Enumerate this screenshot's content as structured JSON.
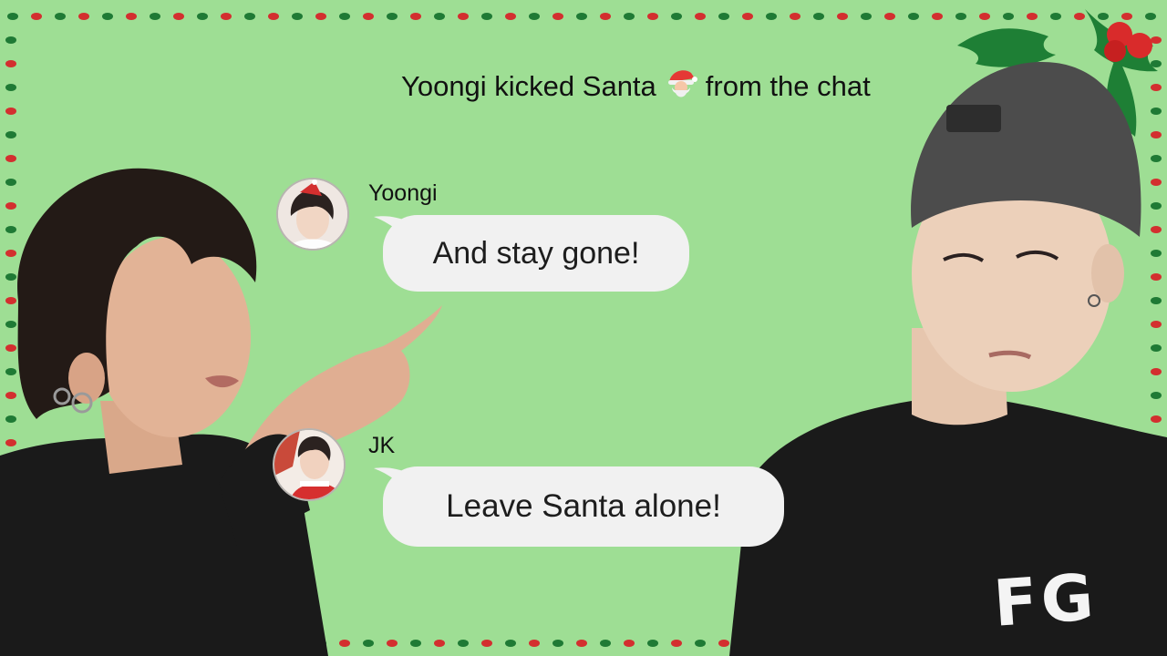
{
  "system_message": {
    "prefix": "Yoongi kicked Santa",
    "emoji_icon": "santa-face-icon",
    "suffix": "from the chat"
  },
  "messages": [
    {
      "sender": "Yoongi",
      "text": "And stay gone!",
      "avatar_icon": "avatar-yoongi-santa-hat"
    },
    {
      "sender": "JK",
      "text": "Leave Santa alone!",
      "avatar_icon": "avatar-jk-santa-outfit"
    }
  ],
  "shirt_print": "FG",
  "colors": {
    "background": "#9ede94",
    "bubble": "#f1f1f1",
    "border_green": "#1f7a35",
    "border_red": "#d32f2f",
    "holly_leaf": "#1e7f35",
    "holly_berry": "#d92b2b"
  }
}
